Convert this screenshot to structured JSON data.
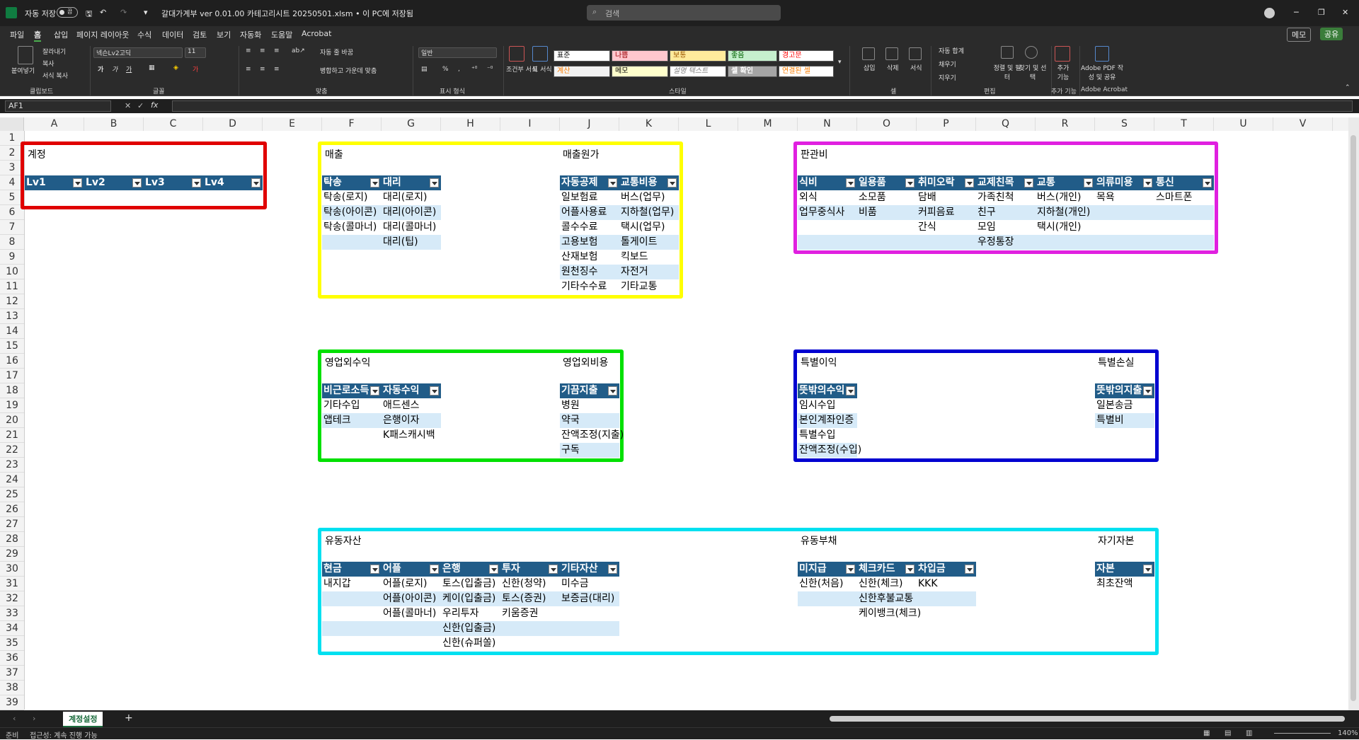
{
  "titlebar": {
    "autosave_label": "자동 저장",
    "autosave_state": "끔",
    "filename": "갈대가계부 ver 0.01.00 카테고리시트 20250501.xlsm • 이 PC에 저장됨",
    "search_placeholder": "검색",
    "min": "─",
    "restore": "❐",
    "close": "✕"
  },
  "menu": {
    "items": [
      "파일",
      "홈",
      "삽입",
      "페이지 레이아웃",
      "수식",
      "데이터",
      "검토",
      "보기",
      "자동화",
      "도움말",
      "Acrobat"
    ],
    "memo": "메모",
    "share": "공유"
  },
  "ribbon": {
    "clipboard": {
      "paste": "붙여넣기",
      "cut": "잘라내기",
      "copy": "복사",
      "format_painter": "서식 복사",
      "group": "클립보드"
    },
    "font": {
      "name": "넥슨Lv2고딕",
      "size": "11",
      "group": "글꼴"
    },
    "align": {
      "wrap": "자동 줄 바꿈",
      "merge": "병합하고 가운데 맞춤",
      "group": "맞춤"
    },
    "number": {
      "format": "일반",
      "group": "표시 형식"
    },
    "cond": {
      "label": "조건부 서식",
      "table": "표 서식"
    },
    "styles": {
      "items": [
        [
          "표준",
          "나쁨",
          "보통",
          "좋음",
          "경고문"
        ],
        [
          "계산",
          "메모",
          "설명 텍스트",
          "셀 확인",
          "연결된 셀"
        ]
      ],
      "group": "스타일"
    },
    "cells": {
      "insert": "삽입",
      "delete": "삭제",
      "format": "서식",
      "group": "셀"
    },
    "edit": {
      "autosum": "자동 합계",
      "fill": "채우기",
      "clear": "지우기",
      "sort": "정렬 및 필터",
      "find": "찾기 및 선택",
      "group": "편집"
    },
    "addins": {
      "label": "추가 기능",
      "group": "추가 기능"
    },
    "adobe": {
      "label": "Adobe PDF 작성 및 공유",
      "group": "Adobe Acrobat"
    }
  },
  "formula": {
    "namebox": "AF1",
    "fx": "fx",
    "cancel": "✕",
    "confirm": "✓"
  },
  "columns": [
    "A",
    "B",
    "C",
    "D",
    "E",
    "F",
    "G",
    "H",
    "I",
    "J",
    "K",
    "L",
    "M",
    "N",
    "O",
    "P",
    "Q",
    "R",
    "S",
    "T",
    "U",
    "V"
  ],
  "rows": [
    "1",
    "2",
    "3",
    "4",
    "5",
    "6",
    "7",
    "8",
    "9",
    "10",
    "11",
    "12",
    "13",
    "14",
    "15",
    "16",
    "17",
    "18",
    "19",
    "20",
    "21",
    "22",
    "23",
    "24",
    "25",
    "26",
    "27",
    "28",
    "29",
    "30",
    "31",
    "32",
    "33",
    "34",
    "35",
    "36",
    "37",
    "38",
    "39"
  ],
  "sections": {
    "account": {
      "title": "계정",
      "headers": [
        "Lv1",
        "Lv2",
        "Lv3",
        "Lv4"
      ]
    },
    "sales": {
      "title": "매출",
      "headers": [
        "탁송",
        "대리"
      ],
      "col1": [
        "탁송(로지)",
        "탁송(아이콘)",
        "탁송(콜마너)"
      ],
      "col2": [
        "대리(로지)",
        "대리(아이콘)",
        "대리(콜마너)",
        "대리(팁)"
      ]
    },
    "cogs": {
      "title": "매출원가",
      "headers": [
        "자동공제",
        "교통비용"
      ],
      "col1": [
        "일보험료",
        "어플사용료",
        "콜수수료",
        "고용보험",
        "산재보험",
        "원천징수",
        "기타수수료"
      ],
      "col2": [
        "버스(업무)",
        "지하철(업무)",
        "택시(업무)",
        "톨게이트",
        "킥보드",
        "자전거",
        "기타교통"
      ]
    },
    "sga": {
      "title": "판관비",
      "headers": [
        "식비",
        "일용품",
        "취미오락",
        "교제친목",
        "교통",
        "의류미용",
        "통신"
      ],
      "rows": [
        [
          "외식",
          "소모품",
          "담배",
          "가족친척",
          "버스(개인)",
          "목욕",
          "스마트폰"
        ],
        [
          "업무중식사",
          "비품",
          "커피음료",
          "친구",
          "지하철(개인)",
          "",
          ""
        ],
        [
          "",
          "",
          "간식",
          "모임",
          "택시(개인)",
          "",
          ""
        ],
        [
          "",
          "",
          "",
          "우정통장",
          "",
          "",
          ""
        ]
      ]
    },
    "nonop_income": {
      "title": "영업외수익",
      "headers": [
        "비근로소득",
        "자동수익"
      ],
      "col1": [
        "기타수입",
        "앱테크"
      ],
      "col2": [
        "애드센스",
        "은행이자",
        "K패스캐시백"
      ]
    },
    "nonop_expense": {
      "title": "영업외비용",
      "headers": [
        "기끔지출"
      ],
      "col1": [
        "병원",
        "약국",
        "잔액조정(지출)",
        "구독"
      ]
    },
    "special_income": {
      "title": "특별이익",
      "headers": [
        "뜻밖의수익"
      ],
      "col1": [
        "임시수입",
        "본인계좌인증",
        "특별수입",
        "잔액조정(수입)"
      ]
    },
    "special_loss": {
      "title": "특별손실",
      "headers": [
        "뜻밖의지출"
      ],
      "col1": [
        "일본송금",
        "특별비"
      ]
    },
    "current_assets": {
      "title": "유동자산",
      "headers": [
        "현금",
        "어플",
        "은행",
        "투자",
        "기타자산"
      ],
      "rows": [
        [
          "내지갑",
          "어플(로지)",
          "토스(입출금)",
          "신한(청약)",
          "미수금"
        ],
        [
          "",
          "어플(아이콘)",
          "케이(입출금)",
          "토스(증권)",
          "보증금(대리)"
        ],
        [
          "",
          "어플(콜마너)",
          "우리투자",
          "키움증권",
          ""
        ],
        [
          "",
          "",
          "신한(입출금)",
          "",
          ""
        ],
        [
          "",
          "",
          "신한(슈퍼쏠)",
          "",
          ""
        ]
      ]
    },
    "current_liab": {
      "title": "유동부채",
      "headers": [
        "미지급",
        "체크카드",
        "차입금"
      ],
      "rows": [
        [
          "신한(처음)",
          "신한(체크)",
          "KKK"
        ],
        [
          "",
          "신한후불교통",
          ""
        ],
        [
          "",
          "케이뱅크(체크)",
          ""
        ]
      ]
    },
    "equity": {
      "title": "자기자본",
      "headers": [
        "자본"
      ],
      "col1": [
        "최초잔액"
      ]
    }
  },
  "sheettabs": {
    "active": "계정설정",
    "add": "+"
  },
  "status": {
    "ready": "준비",
    "accessibility": "접근성: 계속 진행 가능",
    "zoom": "140%"
  },
  "colors": {
    "header": "#215c88",
    "band": "#d6eaf8",
    "red": "#e00000",
    "yellow": "#ffff00",
    "magenta": "#e020e0",
    "green": "#00e000",
    "blue": "#0000d0",
    "cyan": "#00e0f0"
  }
}
